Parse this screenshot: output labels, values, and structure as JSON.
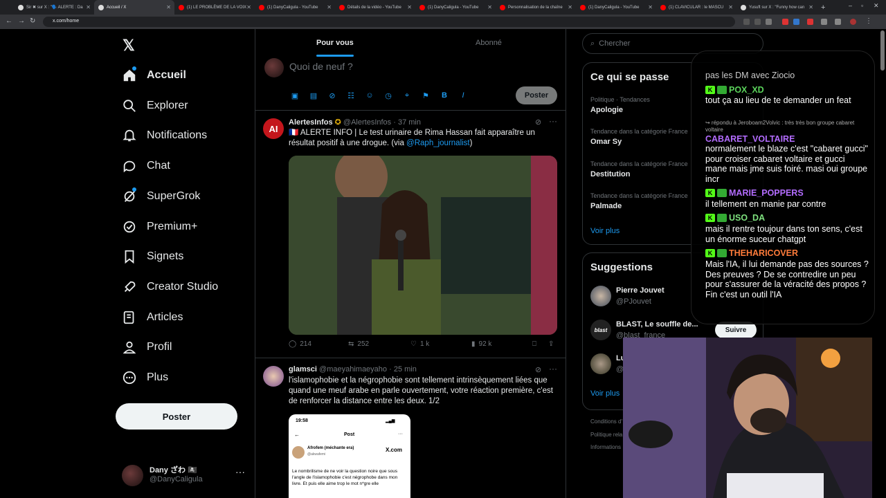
{
  "browser": {
    "tabs": [
      {
        "label": "Sir ✖ sur X : \"🗣️ ALERTE : Da",
        "fav": "#000",
        "active": false
      },
      {
        "label": "Accueil / X",
        "fav": "#000",
        "active": true
      },
      {
        "label": "(1) LE PROBLÈME DE LA VOIX",
        "fav": "#f00",
        "active": false
      },
      {
        "label": "(1) DanyCaligula - YouTube",
        "fav": "#f00",
        "active": false
      },
      {
        "label": "Détails de la vidéo - YouTube",
        "fav": "#f00",
        "active": false
      },
      {
        "label": "(1) DanyCaligula - YouTube",
        "fav": "#f00",
        "active": false
      },
      {
        "label": "Personnalisation de la chaîne",
        "fav": "#f00",
        "active": false
      },
      {
        "label": "(1) DanyCaligula - YouTube",
        "fav": "#f00",
        "active": false
      },
      {
        "label": "(1) CLAVICULAR : le MASCU",
        "fav": "#f00",
        "active": false
      },
      {
        "label": "Yusuft sur X : \"Funny how can",
        "fav": "#000",
        "active": false
      }
    ],
    "url": "x.com/home"
  },
  "sidebar": {
    "logo": "𝕏",
    "items": [
      {
        "label": "Accueil",
        "icon": "home-icon",
        "bold": true
      },
      {
        "label": "Explorer",
        "icon": "search-icon"
      },
      {
        "label": "Notifications",
        "icon": "bell-icon"
      },
      {
        "label": "Chat",
        "icon": "chat-icon"
      },
      {
        "label": "SuperGrok",
        "icon": "grok-icon"
      },
      {
        "label": "Premium+",
        "icon": "premium-icon"
      },
      {
        "label": "Signets",
        "icon": "bookmark-icon"
      },
      {
        "label": "Creator Studio",
        "icon": "rocket-icon"
      },
      {
        "label": "Articles",
        "icon": "article-icon"
      },
      {
        "label": "Profil",
        "icon": "profile-icon"
      },
      {
        "label": "Plus",
        "icon": "more-icon"
      }
    ],
    "post_label": "Poster",
    "account": {
      "name": "Dany ざわ 🏴‍☠️",
      "handle": "@DanyCaligula",
      "more": "···"
    }
  },
  "feed": {
    "tabs": [
      {
        "label": "Pour vous"
      },
      {
        "label": "Abonné"
      }
    ],
    "composer": {
      "placeholder": "Quoi de neuf ?",
      "post_label": "Poster"
    },
    "tweets": [
      {
        "name": "AlertesInfos",
        "handle": "@AlertesInfos",
        "time": "37 min",
        "text_prefix": "🇫🇷 ALERTE INFO | Le test urinaire de Rima Hassan fait apparaître un résultat positif à une drogue. (via ",
        "mention": "@Raph_journalist",
        "text_suffix": ")",
        "replies": "214",
        "reposts": "252",
        "likes": "1 k",
        "views": "92 k"
      },
      {
        "name": "glamsci",
        "handle": "@maeyahimaeyaho",
        "time": "25 min",
        "text": "l'islamophobie et la négrophobie sont tellement intrinsèquement liées que quand une meuf arabe en parle ouvertement, votre réaction première, c'est de renforcer la distance entre les deux. 1/2",
        "embed": {
          "time": "19:58",
          "title": "Post",
          "author": "Afrofem (méchante era)",
          "author_handle": "@akwafemi",
          "brand": "X.com",
          "text": "Le nombrilisme de ne voir la question noire que sous l'angle de l'islamophobie c'est négrophobe dans mon livre. Et puis elle aime trop le mot n*gre elle"
        }
      }
    ]
  },
  "right": {
    "search_placeholder": "Chercher",
    "trends_title": "Ce qui se passe",
    "trends": [
      {
        "category": "Politique · Tendances",
        "name": "Apologie"
      },
      {
        "category": "Tendance dans la catégorie France",
        "name": "Omar Sy"
      },
      {
        "category": "Tendance dans la catégorie France",
        "name": "Destitution"
      },
      {
        "category": "Tendance dans la catégorie France",
        "name": "Palmade"
      }
    ],
    "voir_plus": "Voir plus",
    "suggestions_title": "Suggestions",
    "suggestions": [
      {
        "name": "Pierre Jouvet",
        "handle": "@PJouvet"
      },
      {
        "name": "BLAST, Le souffle de...",
        "handle": "@blast_france",
        "follow": "Suivre"
      },
      {
        "name": "Lu",
        "handle": "@"
      }
    ],
    "voir_plus_2": "Voir plus",
    "footer": [
      "Conditions d'",
      "Politique rela",
      "Informations"
    ]
  },
  "chat": {
    "messages": [
      {
        "type": "text",
        "text": "pas les DM avec Ziocio"
      },
      {
        "type": "user",
        "user": "POX_XD",
        "color": "#5bd45b"
      },
      {
        "type": "text",
        "text": "tout ça au lieu de te demander un feat"
      },
      {
        "type": "reply",
        "text": "↪ répondu à Jeroboam2Volvic : très très bon groupe cabaret voltaire"
      },
      {
        "type": "user",
        "user": "CABARET_VOLTAIRE",
        "color": "#b36cff"
      },
      {
        "type": "text",
        "text": "normalement le blaze c'est \"cabaret gucci\" pour croiser cabaret voltaire et gucci mane mais jme suis foiré. masi oui groupe incr"
      },
      {
        "type": "user",
        "user": "MARIE_POPPERS",
        "color": "#b36cff"
      },
      {
        "type": "text",
        "text": "il tellement en manie par contre"
      },
      {
        "type": "user",
        "user": "USO_DA",
        "color": "#7ee07e"
      },
      {
        "type": "text",
        "text": "mais il rentre toujour dans ton sens, c'est un énorme suceur chatgpt"
      },
      {
        "type": "user",
        "user": "THEHARICOVER",
        "color": "#ff7b3a"
      },
      {
        "type": "text",
        "text": "Mais l'IA, il lui demande pas des sources ? Des preuves ? De se contredire un peu pour s'assurer de la véracité des propos ? Fin c'est un outil l'IA"
      }
    ]
  }
}
